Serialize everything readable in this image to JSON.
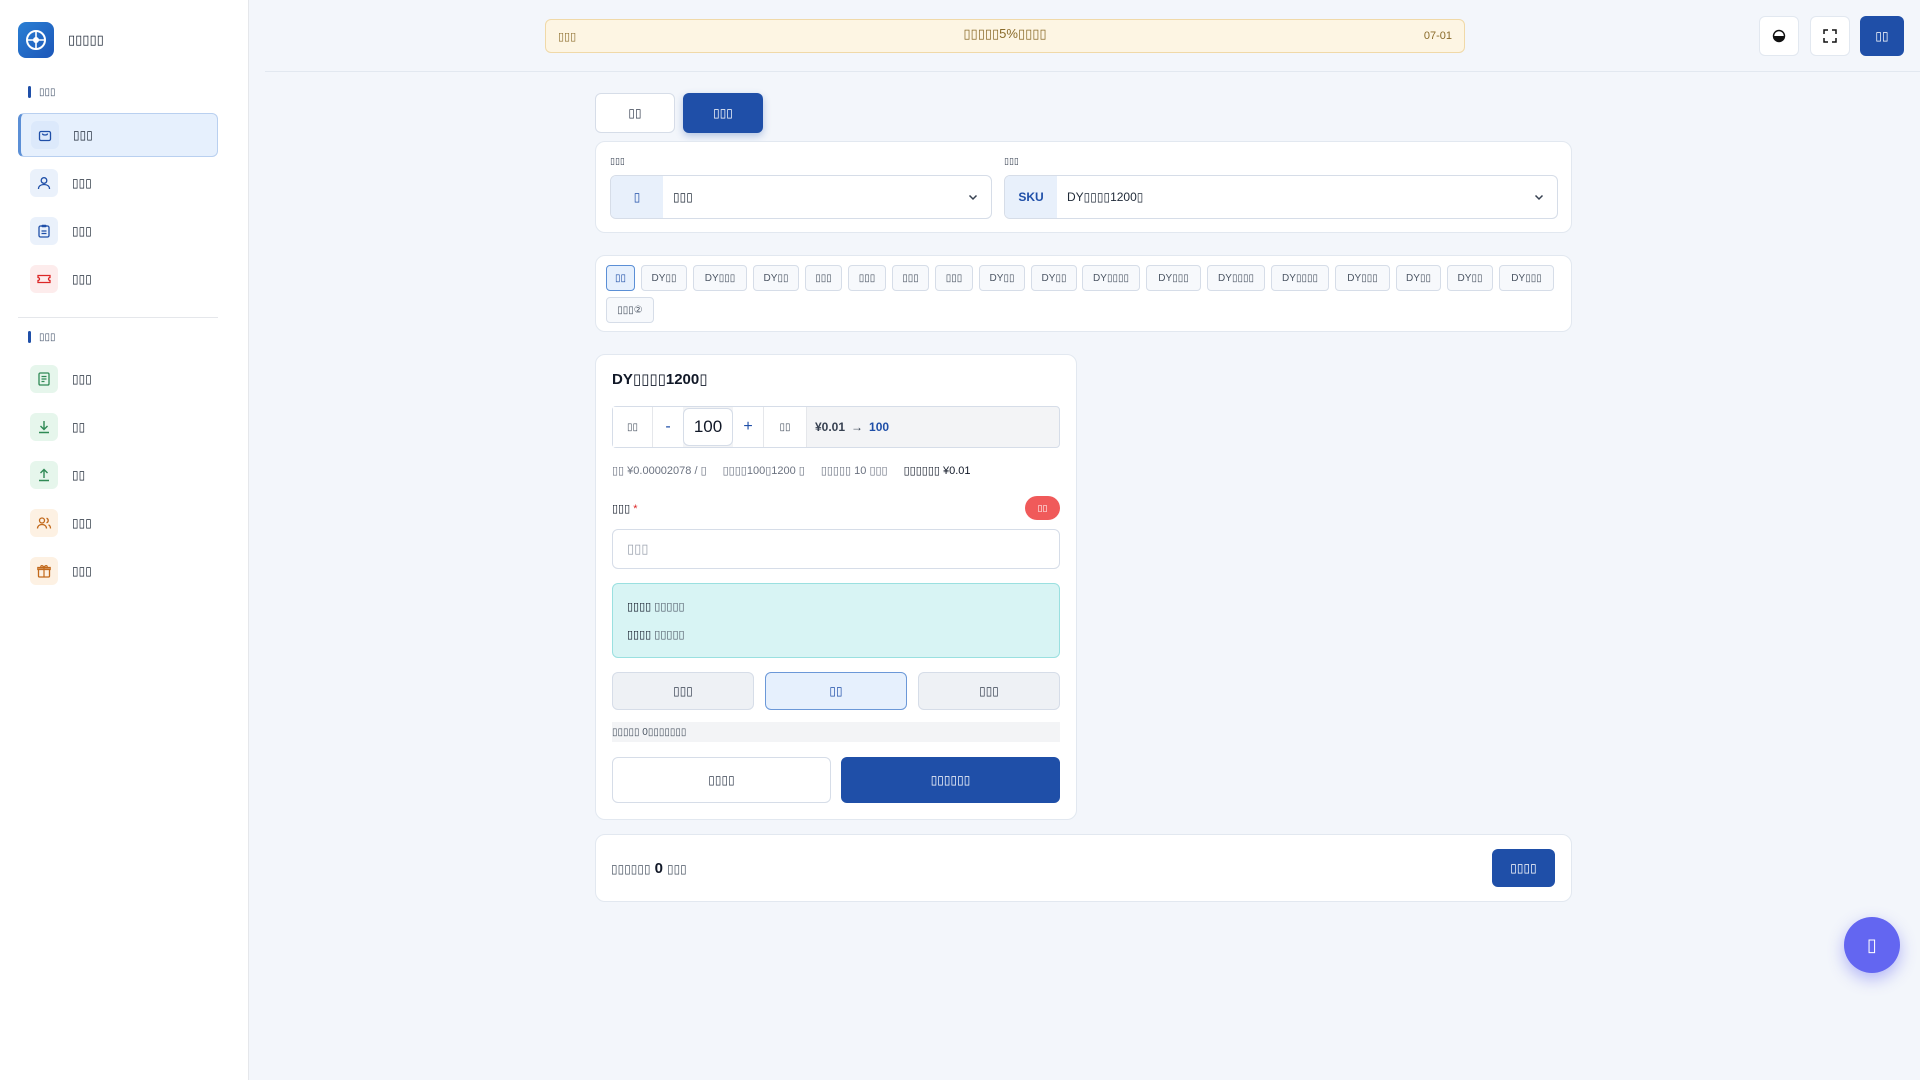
{
  "brand": {
    "name": "▯▯▯▯▯"
  },
  "sidebar": {
    "section1": "▯▯▯",
    "section2": "▯▯▯",
    "items": [
      {
        "label": "▯▯▯",
        "icon": "shopping-bag-icon",
        "color": "#e6f0fd"
      },
      {
        "label": "▯▯▯",
        "icon": "user-icon",
        "color": "#eaf1fb"
      },
      {
        "label": "▯▯▯",
        "icon": "clipboard-icon",
        "color": "#eaf1fb"
      },
      {
        "label": "▯▯▯",
        "icon": "ticket-icon",
        "color": "#fdecec"
      },
      {
        "label": "▯▯▯",
        "icon": "document-icon",
        "color": "#e6f6ec"
      },
      {
        "label": "▯▯",
        "icon": "download-icon",
        "color": "#e6f6ec"
      },
      {
        "label": "▯▯",
        "icon": "upload-icon",
        "color": "#e6f6ec"
      },
      {
        "label": "▯▯▯",
        "icon": "users-icon",
        "color": "#fdf1e3"
      },
      {
        "label": "▯▯▯",
        "icon": "gift-icon",
        "color": "#fdf1e3"
      }
    ]
  },
  "notice": {
    "tag": "▯▯▯",
    "text": "▯▯▯▯▯5%▯▯▯▯",
    "date": "07-01"
  },
  "header": {
    "login": "▯▯"
  },
  "tabs": [
    "▯▯",
    "▯▯▯"
  ],
  "selectors": {
    "category_label": "▯▯▯",
    "category_prefix": "▯",
    "category_value": "▯▯▯",
    "product_label": "▯▯▯",
    "product_prefix": "SKU",
    "product_value": "DY▯▯▯▯1200▯"
  },
  "chips": [
    "▯▯",
    "DY▯▯",
    "DY▯▯▯",
    "DY▯▯",
    "▯▯▯",
    "▯▯▯",
    "▯▯▯",
    "▯▯▯",
    "DY▯▯",
    "DY▯▯",
    "DY▯▯▯▯",
    "DY▯▯▯",
    "DY▯▯▯▯",
    "DY▯▯▯▯",
    "DY▯▯▯",
    "DY▯▯",
    "DY▯▯",
    "DY▯▯▯",
    "▯▯▯②"
  ],
  "order": {
    "title": "DY▯▯▯▯1200▯",
    "qty_label": "▯▯",
    "minus": "-",
    "quantity": "100",
    "plus": "+",
    "price_label": "▯▯",
    "price_from": "¥0.01",
    "arrow": "→",
    "price_to": "100",
    "meta_unit": "▯▯ ¥0.00002078 / ▯",
    "meta_range": "▯▯▯▯100▯1200 ▯",
    "meta_speed": "▯▯▯▯▯ 10 ▯▯▯",
    "meta_total": "▯▯▯▯▯▯ ¥0.01",
    "link_label": "▯▯▯",
    "required_mark": "*",
    "red_pill": "▯▯",
    "link_placeholder": "▯▯▯",
    "info1_strong": "▯▯▯▯",
    "info1_sub": "▯▯▯▯▯",
    "info2_strong": "▯▯▯▯",
    "info2_sub": "▯▯▯▯▯",
    "options": [
      "▯▯▯",
      "▯▯",
      "▯▯▯"
    ],
    "hint": "▯▯▯▯▯ 0▯▯▯▯▯▯▯",
    "btn_secondary": "▯▯▯▯",
    "btn_primary": "▯▯▯▯▯▯"
  },
  "cart": {
    "prefix": "▯▯▯▯▯▯",
    "count": "0",
    "suffix": "▯▯▯",
    "button": "▯▯▯▯"
  },
  "fab": {
    "icon": "chat-icon",
    "glyph": "▯"
  }
}
